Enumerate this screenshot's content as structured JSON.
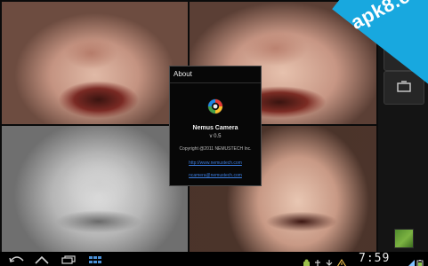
{
  "dialog": {
    "title": "About",
    "app_name": "Nemus Camera",
    "version": "v 0.5",
    "copyright": "Copyright @2011 NEMUSTECH Inc.",
    "website": "http://www.nemustech.com",
    "email": "ncamera@nemustech.com"
  },
  "watermark": {
    "text": "apk8.com",
    "color": "#18a8df"
  },
  "statusbar": {
    "time": "7:59"
  },
  "grid": {
    "photos": [
      {
        "name": "photo-top-left",
        "filter": "color"
      },
      {
        "name": "photo-top-right",
        "filter": "color"
      },
      {
        "name": "photo-bottom-left",
        "filter": "sketch"
      },
      {
        "name": "photo-bottom-right",
        "filter": "color"
      }
    ]
  },
  "icons": {
    "rail": [
      "camera-switch-icon",
      "effect-icon",
      "fullscreen-icon"
    ],
    "nav": [
      "back-icon",
      "home-icon",
      "recent-apps-icon",
      "menu-icon"
    ]
  }
}
